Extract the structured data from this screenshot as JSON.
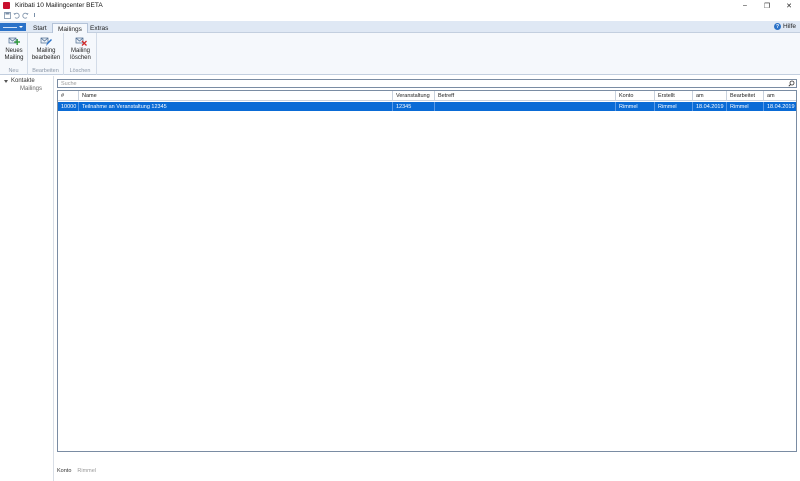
{
  "window": {
    "title": "Kiribati 10 Mailingcenter BETA",
    "controls": [
      "–",
      "❐",
      "✕"
    ]
  },
  "ribbon": {
    "tabs": [
      {
        "label": "Start"
      },
      {
        "label": "Mailings"
      },
      {
        "label": "Extras"
      }
    ],
    "help_label": "Hilfe",
    "groups": [
      {
        "button_line1": "Neues",
        "button_line2": "Mailing",
        "group_label": "Neu"
      },
      {
        "button_line1": "Mailing",
        "button_line2": "bearbeiten",
        "group_label": "Bearbeiten"
      },
      {
        "button_line1": "Mailing",
        "button_line2": "löschen",
        "group_label": "Löschen"
      }
    ]
  },
  "nav": {
    "root": "Kontakte",
    "child": "Mailings"
  },
  "search": {
    "placeholder": "Suche"
  },
  "grid": {
    "columns": [
      "#",
      "Name",
      "Veranstaltung",
      "Betreff",
      "Konto",
      "Erstellt",
      "am",
      "Bearbeitet",
      "am"
    ],
    "rows": [
      {
        "id": "10000",
        "name": "Teilnahme an Veranstaltung 12345",
        "veranstaltung": "12345",
        "betreff": "",
        "konto": "Rimmel",
        "erstellt": "Rimmel",
        "erstellt_am": "18.04.2019",
        "bearbeitet": "Rimmel",
        "bearbeitet_am": "18.04.2019"
      }
    ]
  },
  "status": {
    "label": "Konto",
    "value": "Rimmel"
  },
  "colors": {
    "accent": "#2b72c8",
    "selection": "#0a6bd6",
    "ribbon_bg": "#f5f8fc"
  }
}
